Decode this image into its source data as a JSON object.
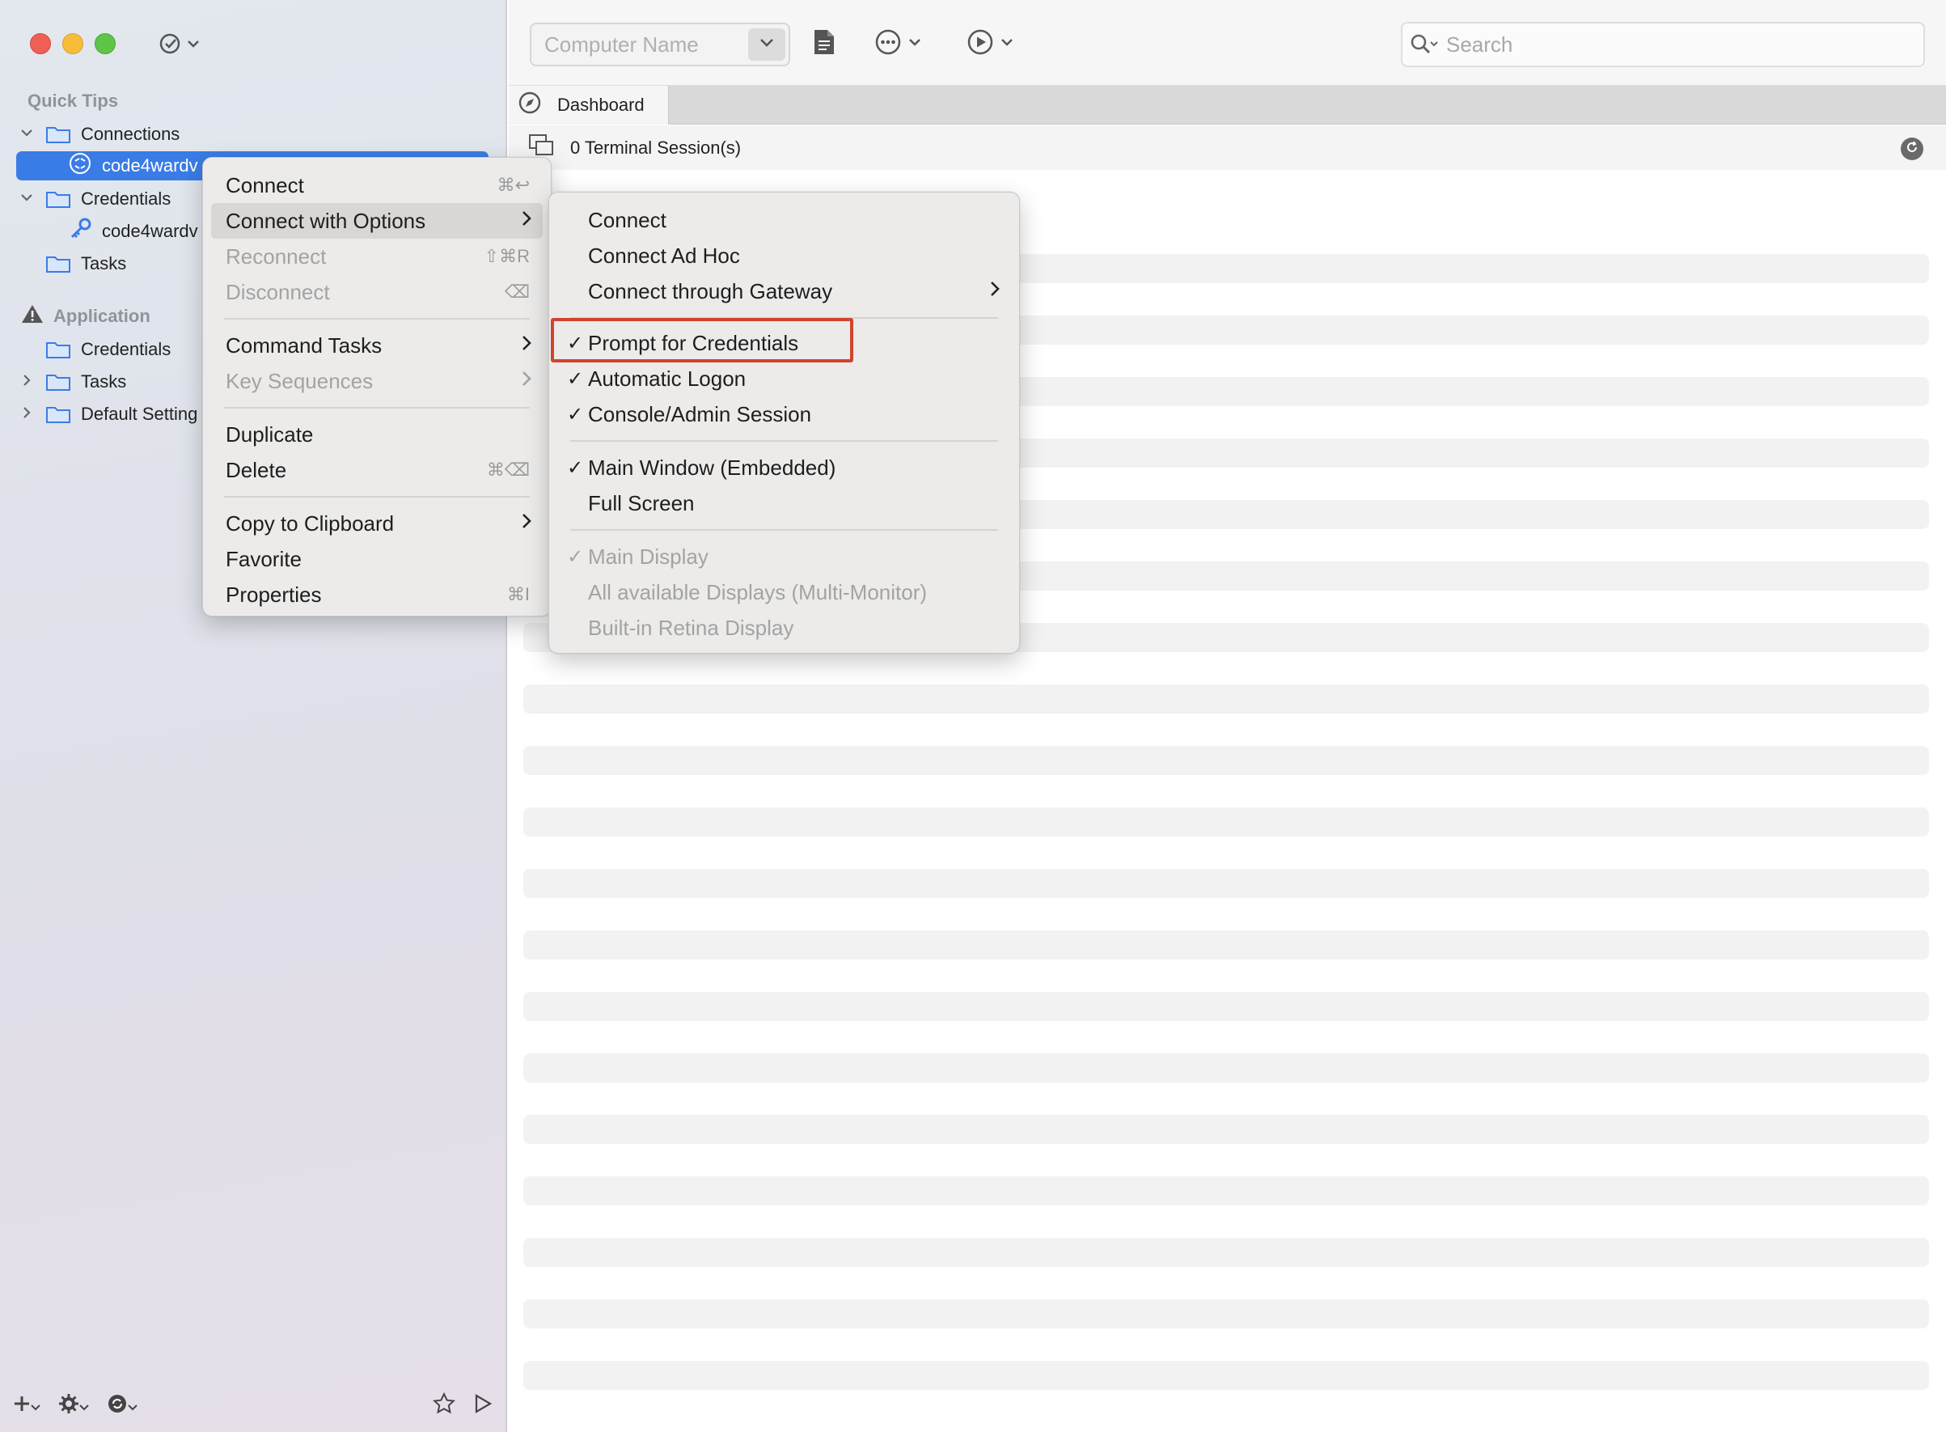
{
  "sidebar": {
    "section_quick_tips": "Quick Tips",
    "section_application": "Application",
    "tree": {
      "connections": "Connections",
      "connection_item": "code4wardv",
      "credentials": "Credentials",
      "credential_item": "code4wardv",
      "tasks": "Tasks",
      "app_credentials": "Credentials",
      "app_tasks": "Tasks",
      "default_settings": "Default Setting"
    },
    "accent_color": "#3a7ce6"
  },
  "toolbar": {
    "computer_name_placeholder": "Computer Name",
    "search_placeholder": "Search"
  },
  "tabs": [
    {
      "label": "Dashboard"
    }
  ],
  "dashboard": {
    "sessions_label": "0 Terminal Session(s)"
  },
  "context_menu": {
    "items": {
      "connect": "Connect",
      "connect_shortcut": "⌘↩",
      "connect_with_options": "Connect with Options",
      "reconnect": "Reconnect",
      "reconnect_shortcut": "⇧⌘R",
      "disconnect": "Disconnect",
      "disconnect_shortcut": "⌫",
      "command_tasks": "Command Tasks",
      "key_sequences": "Key Sequences",
      "duplicate": "Duplicate",
      "delete": "Delete",
      "delete_shortcut": "⌘⌫",
      "copy_to_clipboard": "Copy to Clipboard",
      "favorite": "Favorite",
      "properties": "Properties",
      "properties_shortcut": "⌘I"
    }
  },
  "submenu": {
    "items": {
      "connect": "Connect",
      "connect_ad_hoc": "Connect Ad Hoc",
      "connect_through_gateway": "Connect through Gateway",
      "prompt_for_credentials": "Prompt for Credentials",
      "automatic_logon": "Automatic Logon",
      "console_admin_session": "Console/Admin Session",
      "main_window_embedded": "Main Window (Embedded)",
      "full_screen": "Full Screen",
      "main_display": "Main Display",
      "all_displays": "All available Displays (Multi-Monitor)",
      "builtin_retina": "Built-in Retina Display"
    },
    "check_mark": "✓",
    "highlight_color": "#d14430"
  }
}
